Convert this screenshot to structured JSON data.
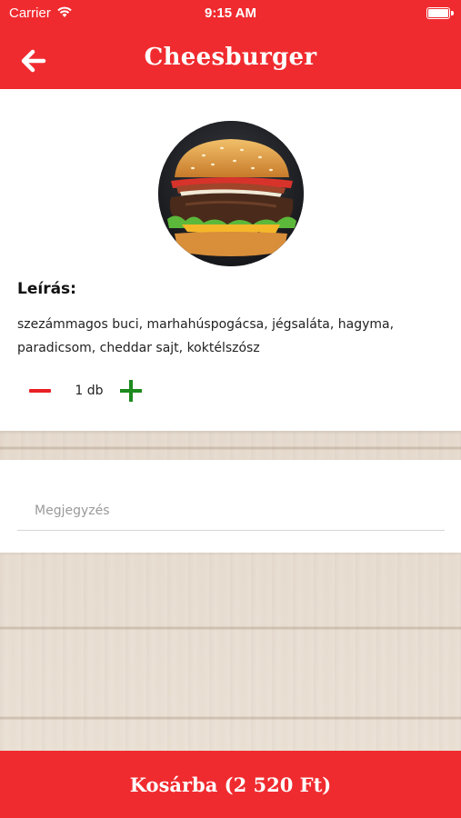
{
  "status_bar": {
    "carrier": "Carrier",
    "time": "9:15 AM",
    "wifi_icon": "wifi-icon",
    "battery_icon": "battery-icon"
  },
  "header": {
    "title": "Cheesburger",
    "back_icon": "arrow-left-icon",
    "background_color": "#f02b2f"
  },
  "product": {
    "image": "burger-photo",
    "description_label": "Leírás:",
    "description": "szezámmagos buci, marhahúspogácsa, jégsaláta, hagyma, paradicsom, cheddar sajt, koktélszósz"
  },
  "quantity": {
    "minus_icon": "minus-icon",
    "value": "1 db",
    "plus_icon": "plus-icon",
    "minus_color": "#e82024",
    "plus_color": "#1d8a1d"
  },
  "note": {
    "placeholder": "Megjegyzés",
    "value": ""
  },
  "cart_button": {
    "label": "Kosárba (2 520 Ft)"
  }
}
